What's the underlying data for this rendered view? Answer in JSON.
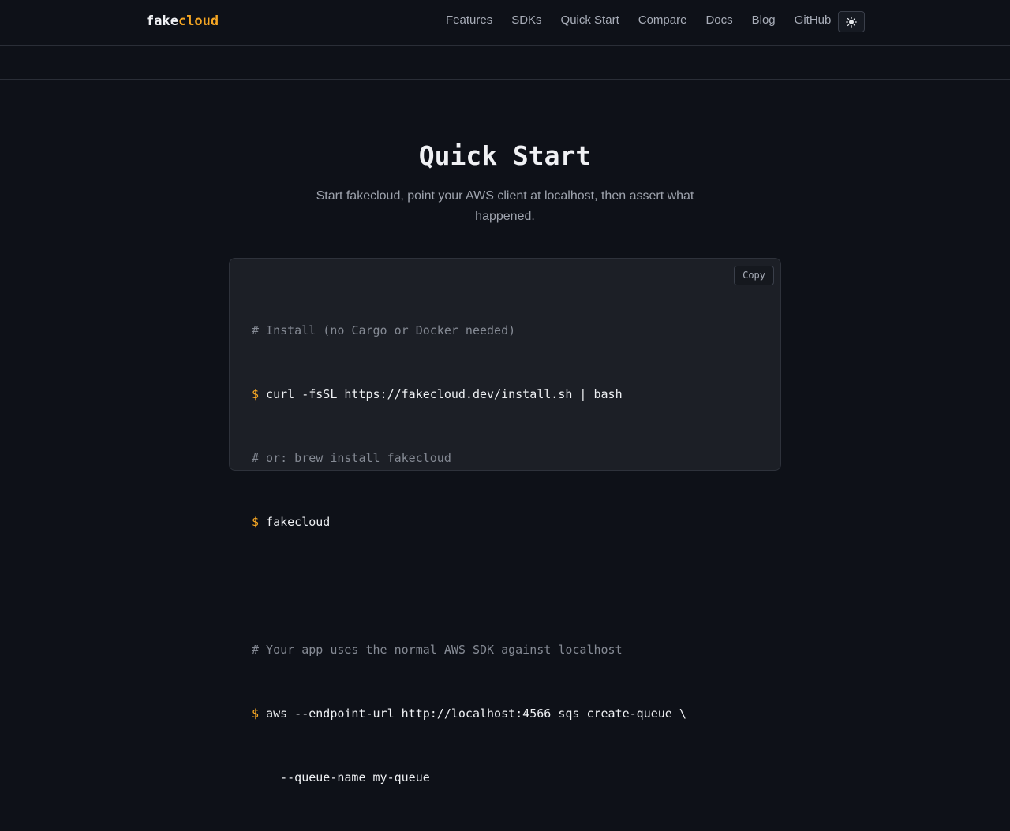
{
  "nav": {
    "logo_part1": "fake",
    "logo_part2": "cloud",
    "links": [
      "Features",
      "SDKs",
      "Quick Start",
      "Compare",
      "Docs",
      "Blog",
      "GitHub"
    ],
    "theme_icon": "sun-icon"
  },
  "hero": {
    "title": "Quick Start",
    "subtitle": "Start fakecloud, point your AWS client at localhost, then assert what happened."
  },
  "code": {
    "copy_label": "Copy",
    "prompt_symbol": "$",
    "lines": {
      "l1": "# Install (no Cargo or Docker needed)",
      "l2": "curl -fsSL https://fakecloud.dev/install.sh | bash",
      "l3": "# or: brew install fakecloud",
      "l4": "fakecloud",
      "l6": "# Your app uses the normal AWS SDK against localhost",
      "l7": "aws --endpoint-url http://localhost:4566 sqs create-queue \\",
      "l8": "  --queue-name my-queue"
    }
  },
  "colors": {
    "accent": "#f5a623",
    "background": "#0e1118"
  }
}
